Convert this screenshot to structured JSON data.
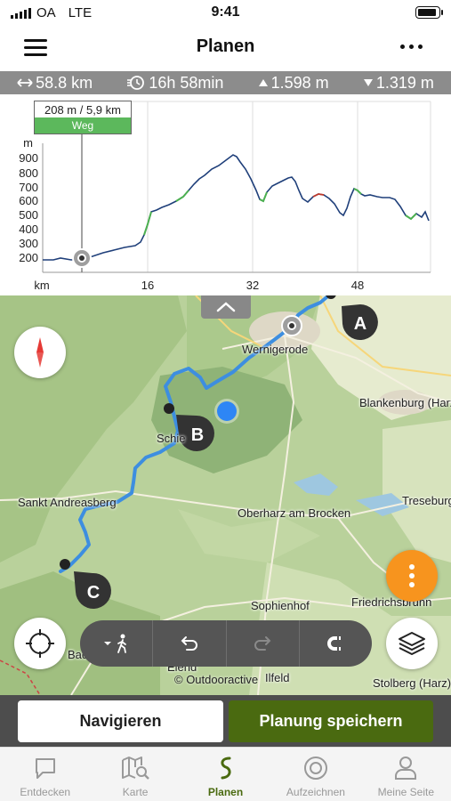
{
  "status_bar": {
    "carrier": "OA",
    "network": "LTE",
    "time": "9:41",
    "battery_level": 0.9
  },
  "nav": {
    "title": "Planen",
    "menu_icon": "hamburger-icon",
    "more_icon": "ellipsis-icon"
  },
  "stats": {
    "distance": "58.8 km",
    "duration": "16h 58min",
    "ascent": "1.598 m",
    "descent": "1.319 m"
  },
  "profile": {
    "tooltip_value": "208 m / 5,9 km",
    "tooltip_type": "Weg",
    "y_unit": "m",
    "x_unit": "km",
    "y_ticks": [
      "900",
      "800",
      "700",
      "600",
      "500",
      "400",
      "300",
      "200"
    ],
    "x_ticks": [
      "16",
      "32",
      "48"
    ],
    "colors": {
      "line": "#1f3f7a",
      "path_green": "#4cb050",
      "grid": "#dddddd",
      "marker": "#999999"
    }
  },
  "map": {
    "places": {
      "wernigerode": "Wernigerode",
      "blankenburg": "Blankenburg (Harz)",
      "schierke": "Schie",
      "sankt_andreasberg": "Sankt Andreasberg",
      "oberharz": "Oberharz am Brocken",
      "treseburg": "Treseburg",
      "friedrichsbrunn": "Friedrichsbrunn",
      "sophienhof": "Sophienhof",
      "bad": "Bad",
      "elend": "Elend",
      "ilfeld": "Ilfeld",
      "stolberg": "Stolberg (Harz)"
    },
    "waypoints": [
      "A",
      "B",
      "C"
    ],
    "attribution": "© Outdooractive",
    "colors": {
      "route": "#3d8ee0",
      "waypoint": "#333333",
      "position": "#2e86f5",
      "fab": "#f7941e"
    }
  },
  "toolbar": {
    "mode_icon": "walking-icon",
    "undo_icon": "undo-icon",
    "redo_icon": "redo-icon",
    "magnet_icon": "magnet-icon"
  },
  "actions": {
    "navigate": "Navigieren",
    "save": "Planung speichern"
  },
  "tabs": [
    {
      "label": "Entdecken",
      "icon": "chat-bubble-icon",
      "active": false
    },
    {
      "label": "Karte",
      "icon": "map-search-icon",
      "active": false
    },
    {
      "label": "Planen",
      "icon": "route-squiggle-icon",
      "active": true
    },
    {
      "label": "Aufzeichnen",
      "icon": "record-icon",
      "active": false
    },
    {
      "label": "Meine Seite",
      "icon": "person-icon",
      "active": false
    }
  ]
}
